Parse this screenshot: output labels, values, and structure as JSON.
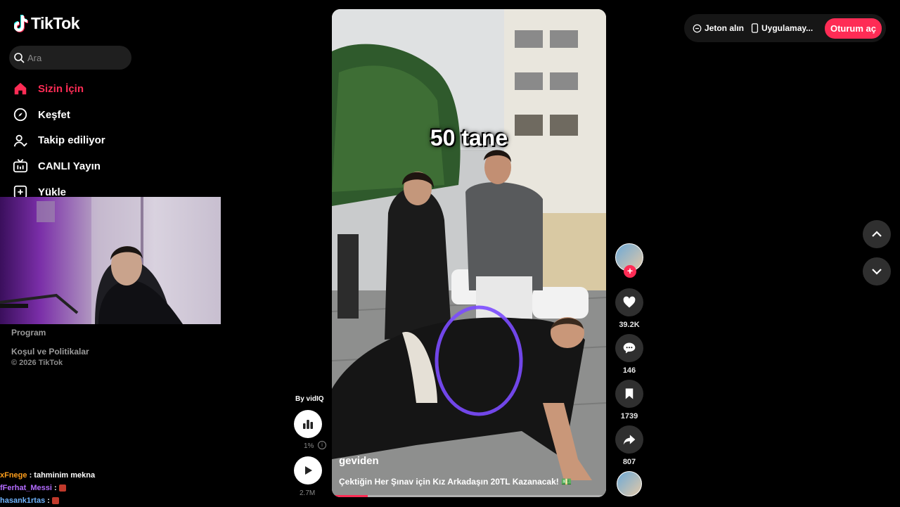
{
  "app": {
    "logo_text": "TikTok"
  },
  "search": {
    "placeholder": "Ara"
  },
  "nav": [
    {
      "label": "Sizin İçin",
      "icon": "home-icon",
      "active": true
    },
    {
      "label": "Keşfet",
      "icon": "compass-icon"
    },
    {
      "label": "Takip ediliyor",
      "icon": "following-icon"
    },
    {
      "label": "CANLI Yayın",
      "icon": "live-icon"
    },
    {
      "label": "Yükle",
      "icon": "upload-icon"
    }
  ],
  "footer": {
    "program": "Program",
    "terms": "Koşul ve Politikalar",
    "copyright": "© 2026 TikTok"
  },
  "chat": [
    {
      "user": "xFnege",
      "message": "tahminim mekna"
    },
    {
      "user": "fFerhat_Messi",
      "message": ""
    },
    {
      "user": "hasank1rtas",
      "message": ""
    }
  ],
  "video": {
    "overlay_text": "50 tane",
    "author": "geviden",
    "caption": "Çektiğin Her Şınav için Kız Arkadaşın 20TL Kazanacak! 💵",
    "progress": 0.13
  },
  "vidiq": {
    "label": "By vidIQ",
    "percent": "1%",
    "play_count": "2.7M"
  },
  "actions": {
    "likes": "39.2K",
    "comments": "146",
    "saves": "1739",
    "shares": "807"
  },
  "topbar": {
    "coins": "Jeton alın",
    "app": "Uygulamay...",
    "login": "Oturum aç"
  },
  "colors": {
    "accent": "#fe2c55",
    "background": "#000000",
    "button_bg": "#2f2f2f"
  }
}
